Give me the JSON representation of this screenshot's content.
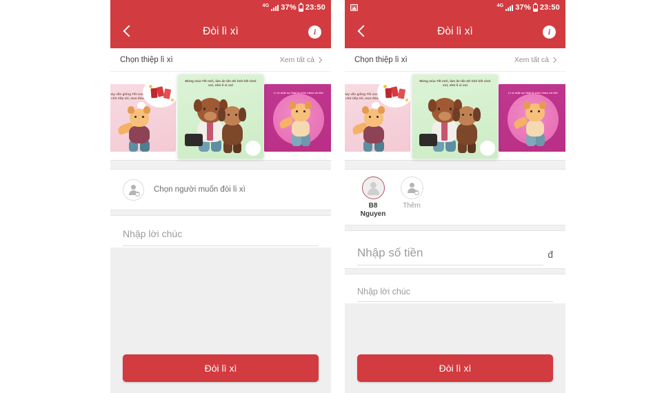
{
  "meta": {
    "accent_red": "#d23b3f",
    "page_background": "#ffffff",
    "panel_gray": "#efefef"
  },
  "status_bar": {
    "network": "4G",
    "battery_percent": "37%",
    "clock": "23:50",
    "gallery_icon": "gallery-icon",
    "signal_icon": "signal-bars-icon",
    "battery_icon": "battery-icon"
  },
  "app_bar": {
    "back_icon": "chevron-left-icon",
    "title": "Đòi lì xì",
    "info_icon": "info-icon",
    "info_label": "i"
  },
  "card_section": {
    "title": "Chọn thiệp lì xì",
    "see_all": "Xem tất cả",
    "chevron_icon": "chevron-right-icon",
    "cards": [
      {
        "id": "card-pink",
        "selected": false,
        "background": "#f3c9d4",
        "caption": "Tết này vẫn giống Tết xưa\nAnh chờ tiếp tới, mẹo đứa lì xì"
      },
      {
        "id": "card-green",
        "selected": true,
        "background": "#cdedc6",
        "caption": "Mừng mùa Tết mới, làm ăn tấn tới\ntình hết chơi vơi, nhờ lì xì vơi"
      },
      {
        "id": "card-magenta",
        "selected": false,
        "background": "#b92f86",
        "caption": "Lì xì một sự thật là nhớ nhau cả đời"
      }
    ]
  },
  "left_phone": {
    "picker": {
      "icon": "person-add-icon",
      "label": "Chọn người muốn đòi lì xì"
    },
    "wish_field": {
      "placeholder": "Nhập lời chúc",
      "value": ""
    },
    "cta_label": "Đòi lì xì"
  },
  "right_phone": {
    "contacts": [
      {
        "name": "B8\nNguyen",
        "type": "selected-contact",
        "icon": "avatar-icon"
      },
      {
        "name": "Thêm",
        "type": "add-contact",
        "icon": "person-add-icon"
      }
    ],
    "amount_field": {
      "placeholder": "Nhập số tiền",
      "value": "",
      "currency": "đ"
    },
    "wish_field": {
      "placeholder": "Nhập lời chúc",
      "value": ""
    },
    "cta_label": "Đòi lì xì"
  }
}
